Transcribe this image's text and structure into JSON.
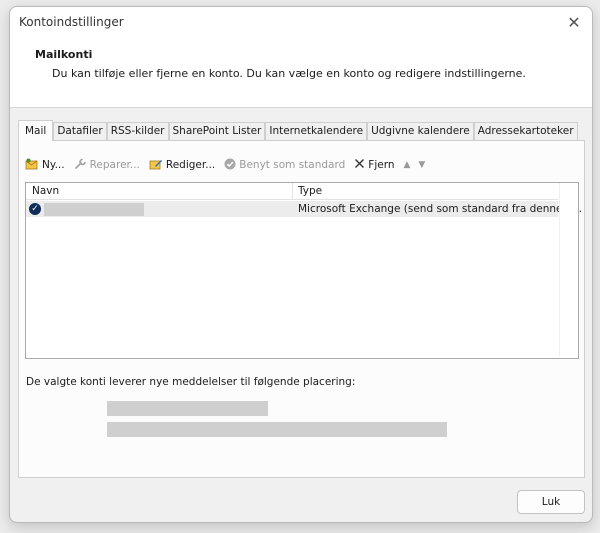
{
  "window": {
    "title": "Kontoindstillinger",
    "close_glyph": "✕"
  },
  "header": {
    "title": "Mailkonti",
    "description": "Du kan tilføje eller fjerne en konto. Du kan vælge en konto og redigere indstillingerne."
  },
  "tabs": [
    {
      "label": "Mail",
      "active": true
    },
    {
      "label": "Datafiler"
    },
    {
      "label": "RSS-kilder"
    },
    {
      "label": "SharePoint Lister"
    },
    {
      "label": "Internetkalendere"
    },
    {
      "label": "Udgivne kalendere"
    },
    {
      "label": "Adressekartoteker"
    }
  ],
  "toolbar": {
    "new_label": "Ny...",
    "repair_label": "Reparer...",
    "edit_label": "Rediger...",
    "default_label": "Benyt som standard",
    "remove_label": "Fjern",
    "icons": {
      "new": "new-account-icon",
      "repair": "wrench-icon",
      "edit": "edit-account-icon",
      "default": "checkmark-circle-icon",
      "remove": "x-icon",
      "up": "arrow-up-icon",
      "down": "arrow-down-icon"
    }
  },
  "accounts_list": {
    "columns": [
      "Navn",
      "Type"
    ],
    "rows": [
      {
        "name": "",
        "type": "Microsoft Exchange (send som standard fra denne k...",
        "default": true
      }
    ]
  },
  "delivery": {
    "label": "De valgte konti leverer nye meddelelser til følgende placering:"
  },
  "footer": {
    "close_label": "Luk"
  },
  "colors": {
    "accent": "#0e2d57",
    "redaction": "#cfcfcf",
    "dialog_bg": "#f0f0f0"
  }
}
